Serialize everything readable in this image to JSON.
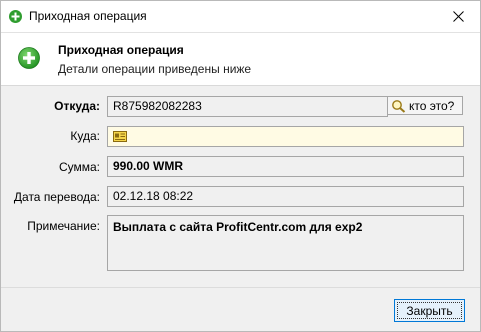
{
  "window": {
    "title": "Приходная операция",
    "accent": "#2f9d2f"
  },
  "header": {
    "title": "Приходная операция",
    "subtitle": "Детали операции приведены ниже",
    "icon": "plus-circle-icon"
  },
  "form": {
    "from_label": "Откуда:",
    "from_value": "R875982082283",
    "whois_label": "кто это?",
    "to_label": "Куда:",
    "to_value": "",
    "amount_label": "Сумма:",
    "amount_value": "990.00 WMR",
    "date_label": "Дата перевода:",
    "date_value": "02.12.18 08:22",
    "note_label": "Примечание:",
    "note_value": "Выплата с сайта ProfitCentr.com для exp2"
  },
  "footer": {
    "close_label": "Закрыть"
  }
}
